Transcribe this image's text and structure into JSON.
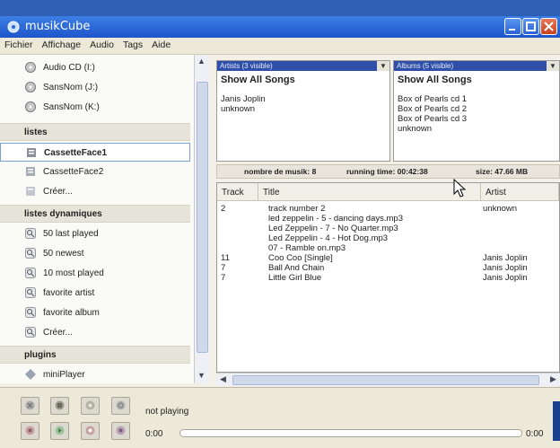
{
  "window": {
    "title": "musikCube"
  },
  "menu": [
    "Fichier",
    "Affichage",
    "Audio",
    "Tags",
    "Aide"
  ],
  "sidebar": {
    "devices": [
      {
        "label": "Audio CD (I:)",
        "icon": "cd-icon"
      },
      {
        "label": "SansNom (J:)",
        "icon": "cd-icon"
      },
      {
        "label": "SansNom (K:)",
        "icon": "cd-icon"
      }
    ],
    "playlists_header": "listes",
    "playlists": [
      {
        "label": "CassetteFace1",
        "selected": true
      },
      {
        "label": "CassetteFace2",
        "selected": false
      },
      {
        "label": "Créer...",
        "selected": false
      }
    ],
    "dynamic_header": "listes dynamiques",
    "dynamic": [
      "50 last played",
      "50 newest",
      "10 most played",
      "favorite artist",
      "favorite album",
      "Créer..."
    ],
    "plugins_header": "plugins",
    "plugins": [
      "miniPlayer"
    ]
  },
  "artists_panel": {
    "header": "Artists (3 visible)",
    "show_all": "Show All Songs",
    "items": [
      "Janis Joplin",
      "unknown"
    ]
  },
  "albums_panel": {
    "header": "Albums (5 visible)",
    "show_all": "Show All Songs",
    "items": [
      "Box of Pearls cd 1",
      "Box of Pearls cd 2",
      "Box of Pearls cd 3",
      "unknown"
    ]
  },
  "stats": {
    "count": "nombre de musik: 8",
    "running": "running time: 00:42:38",
    "size": "size: 47.66 MB"
  },
  "table": {
    "columns": [
      "Track",
      "Title",
      "Artist"
    ],
    "rows": [
      {
        "track": "2",
        "title": "track number 2",
        "artist": "unknown"
      },
      {
        "track": "",
        "title": "led zeppelin - 5 - dancing days.mp3",
        "artist": ""
      },
      {
        "track": "",
        "title": "Led Zeppelin - 7 - No Quarter.mp3",
        "artist": ""
      },
      {
        "track": "",
        "title": "Led Zeppelin - 4 - Hot Dog.mp3",
        "artist": ""
      },
      {
        "track": "",
        "title": "07 - Ramble on.mp3",
        "artist": ""
      },
      {
        "track": "11",
        "title": "Coo Coo [Single]",
        "artist": "Janis Joplin"
      },
      {
        "track": "7",
        "title": "Ball And Chain",
        "artist": "Janis Joplin"
      },
      {
        "track": "7",
        "title": "Little Girl Blue",
        "artist": "Janis Joplin"
      }
    ]
  },
  "player": {
    "status": "not playing",
    "time_start": "0:00",
    "time_end": "0:00",
    "progress": 0
  },
  "colors": {
    "titlebar": "#2c62d6",
    "panel_header": "#2f4fa8",
    "selection_border": "#7aa2d8"
  }
}
